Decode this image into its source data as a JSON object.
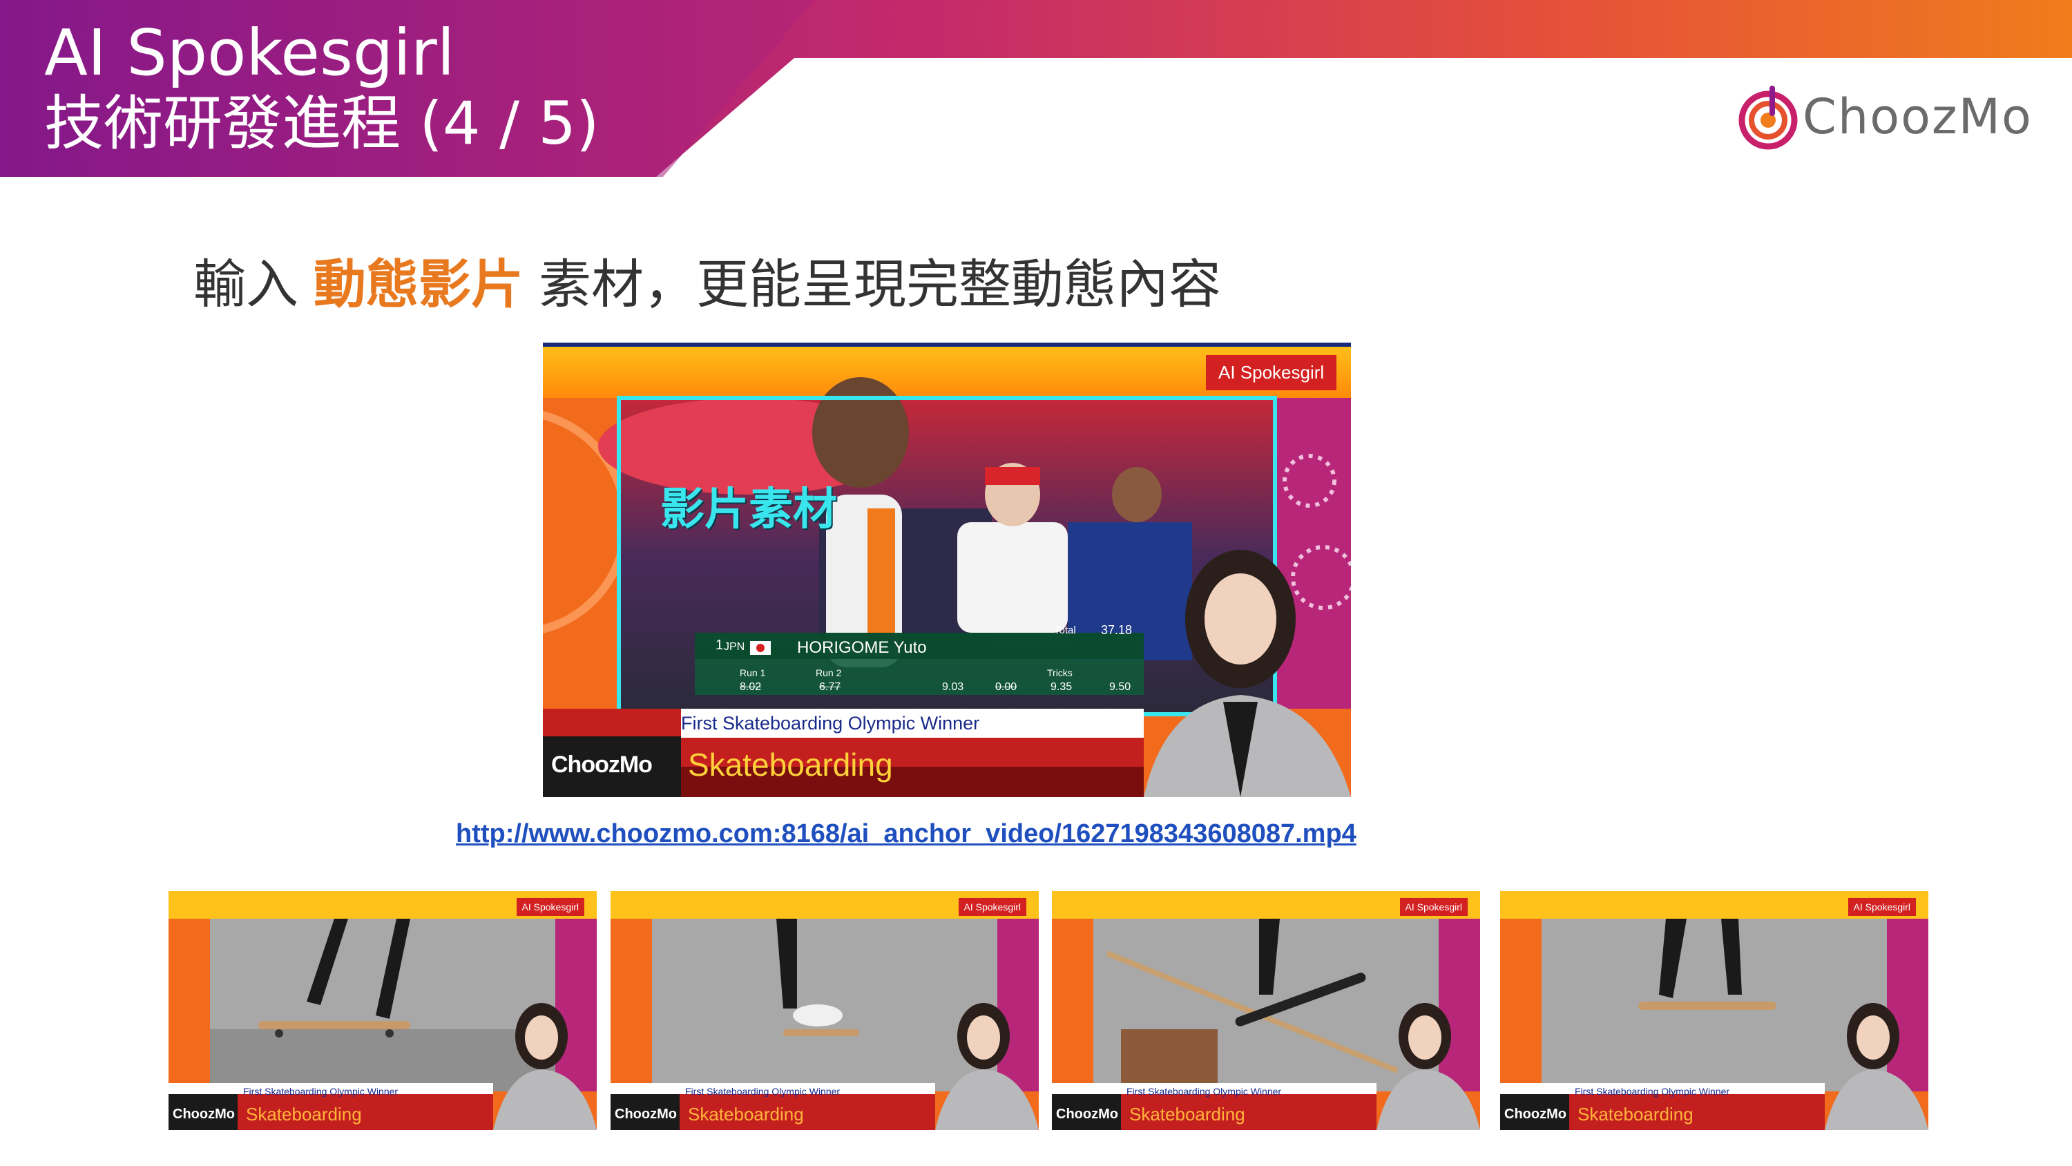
{
  "header": {
    "title_line1": "AI Spokesgirl",
    "title_line2": "技術研發進程 (4 / 5)"
  },
  "logo": {
    "text": "ChoozMo",
    "icon": "choozmo-logo-icon"
  },
  "subtitle": {
    "before": "輸入",
    "highlight": "動態影片",
    "after": "素材，更能呈現完整動態內容"
  },
  "main_video": {
    "badge": "AI Spokesgirl",
    "overlay_label": "影片素材",
    "caption": "First Skateboarding Olympic Winner",
    "topic": "Skateboarding",
    "brand": "ChoozMo",
    "scoreboard": {
      "rank": "1",
      "country": "JPN",
      "name": "HORIGOME Yuto",
      "total_label": "Total",
      "total": "37.18",
      "run1_label": "Run 1",
      "run2_label": "Run 2",
      "tricks_label": "Tricks",
      "run1": "8.02",
      "run2": "6.77",
      "trick_scores": [
        "9.03",
        "0.00",
        "9.35",
        "9.50"
      ]
    }
  },
  "video_link": "http://www.choozmo.com:8168/ai_anchor_video/1627198343608087.mp4",
  "thumbnails": [
    {
      "badge": "AI Spokesgirl",
      "caption": "First Skateboarding Olympic Winner",
      "topic": "Skateboarding",
      "brand": "ChoozMo"
    },
    {
      "badge": "AI Spokesgirl",
      "caption": "First Skateboarding Olympic Winner",
      "topic": "Skateboarding",
      "brand": "ChoozMo"
    },
    {
      "badge": "AI Spokesgirl",
      "caption": "First Skateboarding Olympic Winner",
      "topic": "Skateboarding",
      "brand": "ChoozMo"
    },
    {
      "badge": "AI Spokesgirl",
      "caption": "First Skateboarding Olympic Winner",
      "topic": "Skateboarding",
      "brand": "ChoozMo"
    }
  ],
  "colors": {
    "banner_start": "#8e1a8c",
    "banner_end": "#f07c1c",
    "highlight": "#e9791f",
    "overlay_frame": "#39e6ee",
    "badge_red": "#d32020"
  }
}
